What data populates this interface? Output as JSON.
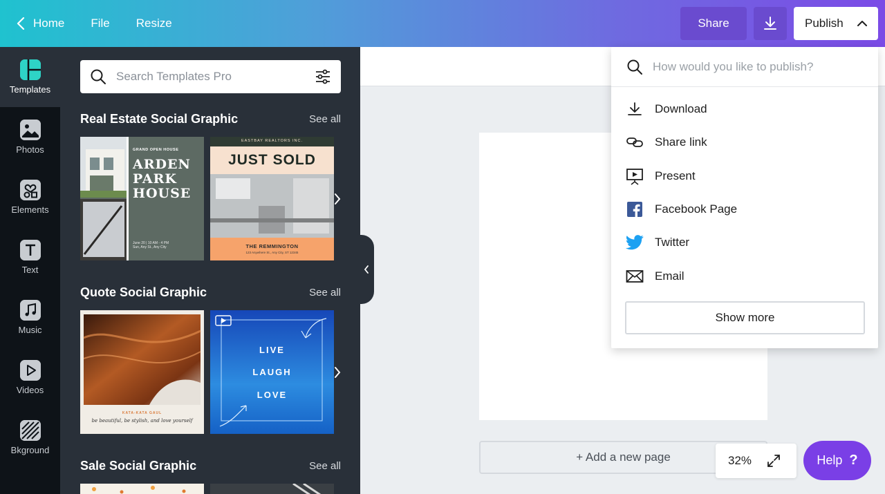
{
  "topbar": {
    "home_label": "Home",
    "file_label": "File",
    "resize_label": "Resize",
    "share_label": "Share",
    "publish_label": "Publish"
  },
  "rail": {
    "items": [
      {
        "label": "Templates",
        "icon": "templates-icon"
      },
      {
        "label": "Photos",
        "icon": "photos-icon"
      },
      {
        "label": "Elements",
        "icon": "elements-icon"
      },
      {
        "label": "Text",
        "icon": "text-icon"
      },
      {
        "label": "Music",
        "icon": "music-icon"
      },
      {
        "label": "Videos",
        "icon": "videos-icon"
      },
      {
        "label": "Bkground",
        "icon": "background-icon"
      }
    ]
  },
  "panel": {
    "search_placeholder": "Search Templates Pro",
    "sections": [
      {
        "title": "Real Estate Social Graphic",
        "see_all": "See all"
      },
      {
        "title": "Quote Social Graphic",
        "see_all": "See all"
      },
      {
        "title": "Sale Social Graphic",
        "see_all": "See all"
      }
    ],
    "thumbs": {
      "arden": {
        "kicker": "GRAND OPEN HOUSE",
        "line1": "ARDEN",
        "line2": "PARK",
        "line3": "HOUSE",
        "footer": "June 20 | 10 AM - 4 PM",
        "footer2": "Sun, Any St., Any City"
      },
      "sold": {
        "realtor": "EASTBAY REALTORS INC.",
        "headline": "JUST SOLD",
        "name": "THE REMMINGTON",
        "address": "123 Anywhere St., Any City, ST 12345"
      },
      "quote1": {
        "author": "KATA-KATA GAUL",
        "text": "be beautiful, be stylish, and love yourself"
      },
      "quote2": {
        "line1": "LIVE",
        "line2": "LAUGH",
        "line3": "LOVE"
      }
    }
  },
  "canvas": {
    "add_page_label": "+ Add a new page",
    "zoom_label": "32%"
  },
  "help": {
    "label": "Help",
    "glyph": "?"
  },
  "publish_menu": {
    "search_placeholder": "How would you like to publish?",
    "items": [
      {
        "label": "Download",
        "icon": "download-icon"
      },
      {
        "label": "Share link",
        "icon": "link-icon"
      },
      {
        "label": "Present",
        "icon": "present-icon"
      },
      {
        "label": "Facebook Page",
        "icon": "facebook-icon",
        "color": "#3b5998"
      },
      {
        "label": "Twitter",
        "icon": "twitter-icon",
        "color": "#1da1f2"
      },
      {
        "label": "Email",
        "icon": "email-icon"
      }
    ],
    "show_more_label": "Show more"
  },
  "colors": {
    "accent_purple": "#7a3fe6",
    "teal": "#2ed3c6",
    "panel_bg": "#293039",
    "rail_bg": "#0e1318"
  }
}
